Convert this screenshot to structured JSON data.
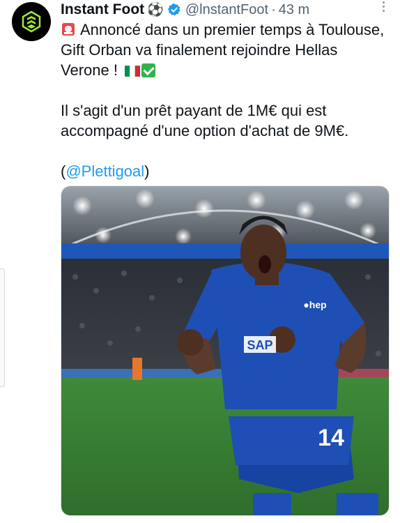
{
  "account": {
    "name": "Instant Foot",
    "name_emoji": "⚽",
    "handle": "@lnstantFoot",
    "separator": "·",
    "time": "43 m",
    "verified": true
  },
  "tweet": {
    "line1_emoji": "🚨",
    "paragraph1": "Annoncé dans un premier temps à Toulouse, Gift Orban va finalement rejoindre Hellas Verone !",
    "paragraph2": "Il s'agit d'un prêt payant de 1M€ qui est accompagné d'une option d'achat de 9M€.",
    "credit_open": "(",
    "credit_mention": "@Plettigoal",
    "credit_close": ")"
  },
  "media": {
    "kit_sponsor": "SAP",
    "kit_secondary": "●hep",
    "shirt_number": "14"
  },
  "colors": {
    "accent": "#1d9bf0",
    "verified": "#1d9bf0",
    "avatar_logo": "#a3e635",
    "kit_blue": "#1e4fb4"
  },
  "icons": [
    "instant-foot-logo",
    "verified-badge",
    "more-icon",
    "siren-emoji",
    "italy-flag-emoji",
    "check-emoji"
  ]
}
